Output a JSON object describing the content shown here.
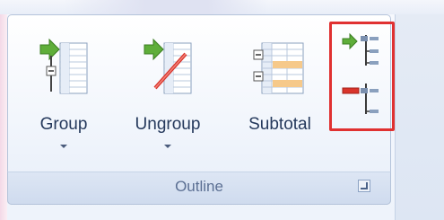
{
  "ribbon": {
    "group_label": "Outline",
    "buttons": [
      {
        "label": "Group",
        "icon": "group-icon",
        "has_dropdown": true
      },
      {
        "label": "Ungroup",
        "icon": "ungroup-icon",
        "has_dropdown": true
      },
      {
        "label": "Subtotal",
        "icon": "subtotal-icon",
        "has_dropdown": false
      }
    ],
    "small_buttons": [
      {
        "icon": "show-detail-icon"
      },
      {
        "icon": "hide-detail-icon"
      }
    ],
    "highlight_color": "#e03131"
  }
}
